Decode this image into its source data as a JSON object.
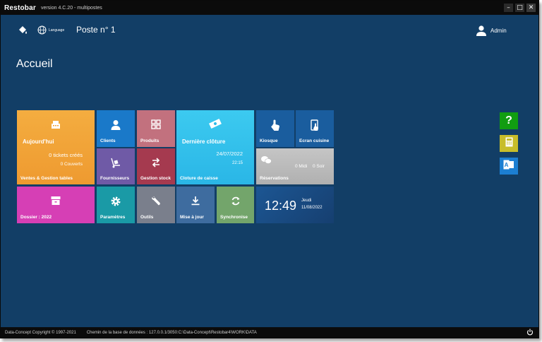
{
  "titlebar": {
    "app_name": "Restobar",
    "version": "version 4.C.20 - multipostes"
  },
  "topbar": {
    "language": "Language",
    "poste": "Poste  n° 1",
    "user": "Admin"
  },
  "page_title": "Accueil",
  "tiles": {
    "aujourdhui": {
      "title": "Aujourd'hui",
      "tickets": "0 tickets créés",
      "couverts": "0 Couverts",
      "label": "Ventes & Gestion tables",
      "color": "#f2a436"
    },
    "clients": {
      "label": "Clients",
      "color": "#1a79c9"
    },
    "produits": {
      "label": "Produits",
      "color": "#c2717e"
    },
    "derniere_cloture": {
      "title": "Dernière clôture",
      "date": "24/07/2022",
      "time": "22:15",
      "label": "Cloture de caisse",
      "color": "#36c1ec"
    },
    "kiosque": {
      "label": "Kiosque",
      "color": "#1a5d9e"
    },
    "ecran_cuisine": {
      "label": "Ecran cuisine",
      "color": "#1a5d9e"
    },
    "fournisseurs": {
      "label": "Fournisseurs",
      "color": "#6f5aa6"
    },
    "gestion_stock": {
      "label": "Gestion stock",
      "color": "#a53a4f"
    },
    "reservations": {
      "midi": "0  Midi",
      "soir": "0  Soir",
      "label": "Réservations",
      "color": "#bcbcbc"
    },
    "dossier": {
      "label": "Dossier : 2022",
      "color": "#d63fb5"
    },
    "parametres": {
      "label": "Paramètres",
      "color": "#1a9aa6"
    },
    "outils": {
      "label": "Outils",
      "color": "#7a7f8c"
    },
    "mise_a_jour": {
      "label": "Mise à jour",
      "color": "#3e6c9f"
    },
    "synchronise": {
      "label": "Synchronise",
      "color": "#73a56b"
    },
    "clock": {
      "time": "12:49",
      "day": "Jeudi",
      "date": "11/08/2022",
      "color": "#1b4f86"
    }
  },
  "side_buttons": {
    "help": "?",
    "help_color": "#119d11",
    "calc_color": "#c7bd2a",
    "outlook_color": "#1c7fd2"
  },
  "statusbar": {
    "copyright": "Data-Concept Copyright © 1997-2021",
    "db_path": "Chemin de la base de données : 127.0.0.1/3050:C:\\Data-Concept\\Restobar4\\WORK\\DATA"
  }
}
